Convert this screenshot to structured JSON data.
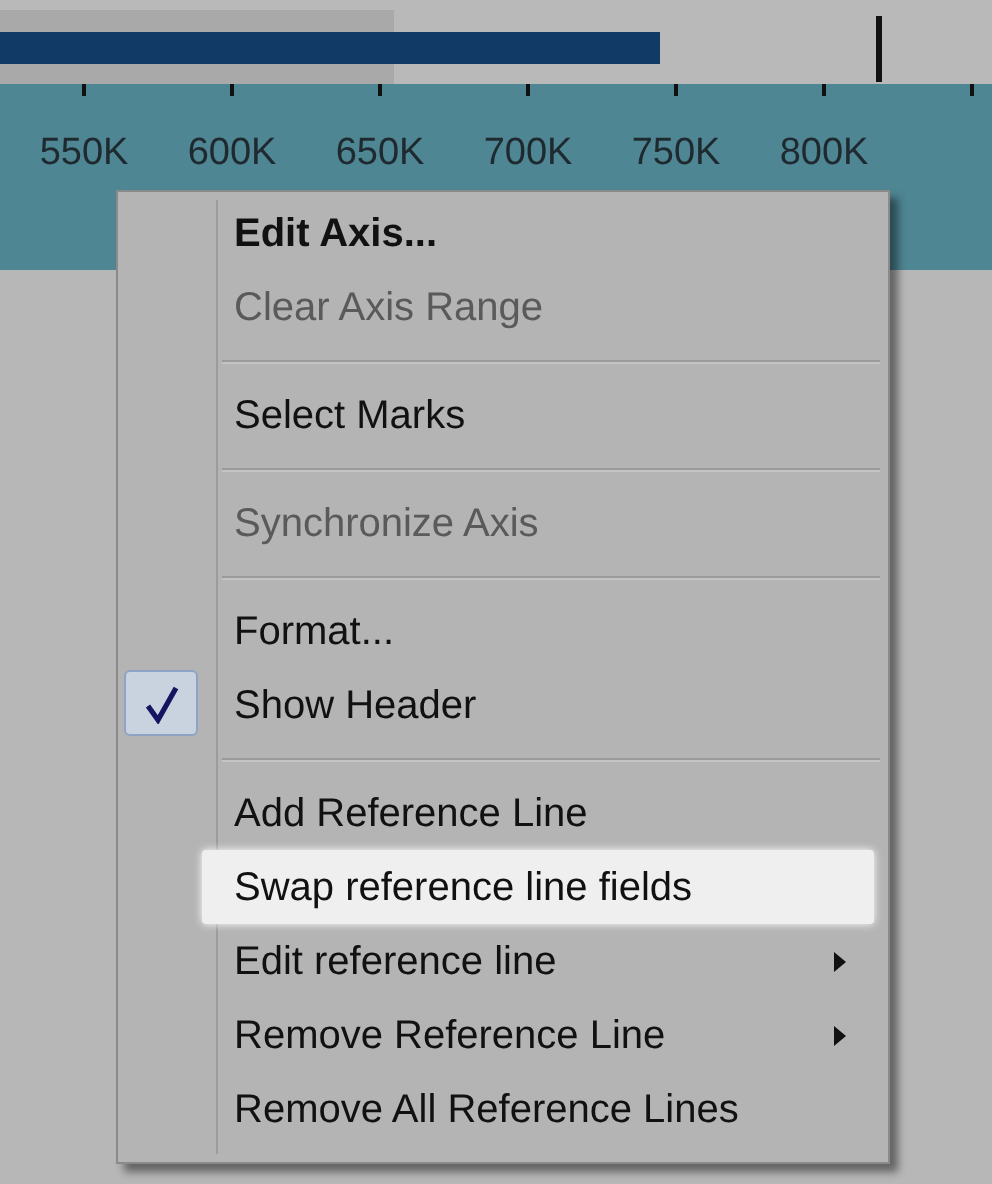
{
  "axis": {
    "tick_labels": [
      "550K",
      "600K",
      "650K",
      "700K",
      "750K",
      "800K"
    ]
  },
  "context_menu": {
    "items": [
      {
        "kind": "item",
        "label": "Edit Axis...",
        "default": true,
        "disabled": false,
        "checked": false,
        "submenu": false,
        "selected": false
      },
      {
        "kind": "item",
        "label": "Clear Axis Range",
        "default": false,
        "disabled": true,
        "checked": false,
        "submenu": false,
        "selected": false
      },
      {
        "kind": "separator"
      },
      {
        "kind": "item",
        "label": "Select Marks",
        "default": false,
        "disabled": false,
        "checked": false,
        "submenu": false,
        "selected": false
      },
      {
        "kind": "separator"
      },
      {
        "kind": "item",
        "label": "Synchronize Axis",
        "default": false,
        "disabled": true,
        "checked": false,
        "submenu": false,
        "selected": false
      },
      {
        "kind": "separator"
      },
      {
        "kind": "item",
        "label": "Format...",
        "default": false,
        "disabled": false,
        "checked": false,
        "submenu": false,
        "selected": false
      },
      {
        "kind": "item",
        "label": "Show Header",
        "default": false,
        "disabled": false,
        "checked": true,
        "submenu": false,
        "selected": false
      },
      {
        "kind": "separator"
      },
      {
        "kind": "item",
        "label": "Add Reference Line",
        "default": false,
        "disabled": false,
        "checked": false,
        "submenu": false,
        "selected": false
      },
      {
        "kind": "item",
        "label": "Swap reference line fields",
        "default": false,
        "disabled": false,
        "checked": false,
        "submenu": false,
        "selected": true
      },
      {
        "kind": "item",
        "label": "Edit reference line",
        "default": false,
        "disabled": false,
        "checked": false,
        "submenu": true,
        "selected": false
      },
      {
        "kind": "item",
        "label": "Remove Reference Line",
        "default": false,
        "disabled": false,
        "checked": false,
        "submenu": true,
        "selected": false
      },
      {
        "kind": "item",
        "label": "Remove All Reference Lines",
        "default": false,
        "disabled": false,
        "checked": false,
        "submenu": false,
        "selected": false
      }
    ]
  }
}
